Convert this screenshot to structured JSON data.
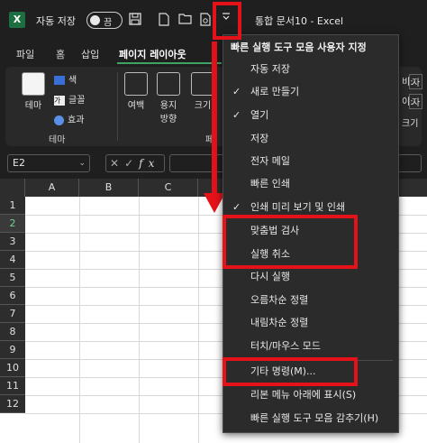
{
  "titlebar": {
    "app_logo": "X",
    "autosave_label": "자동 저장",
    "autosave_state": "끔",
    "window_title": "통합 문서10  -  Excel"
  },
  "tabs": [
    {
      "label": "파일"
    },
    {
      "label": "홈"
    },
    {
      "label": "삽입"
    },
    {
      "label": "페이지 레이아웃",
      "active": true
    }
  ],
  "ribbon": {
    "theme_button": "테마",
    "colors": "색",
    "fonts": "글꼴",
    "effects": "효과",
    "theme_group": "테마",
    "margins": "여백",
    "orientation_l1": "용지",
    "orientation_l2": "방향",
    "size": "크기",
    "page_setup_group_stub": "페",
    "right_a": "비:",
    "right_b": "이:",
    "right_c": "크기",
    "right_a_val": "자",
    "right_b_val": "자"
  },
  "formula_bar": {
    "name_box": "E2",
    "fx": "fx"
  },
  "grid": {
    "columns": [
      "A",
      "B",
      "C"
    ],
    "rows": [
      "1",
      "2",
      "3",
      "4",
      "5",
      "6",
      "7",
      "8",
      "9",
      "10",
      "11",
      "12"
    ],
    "selected_row": "2"
  },
  "qat_menu": {
    "header": "빠른 실행 도구 모음 사용자 지정",
    "items": [
      {
        "label": "자동 저장",
        "checked": false
      },
      {
        "label": "새로 만들기",
        "checked": true
      },
      {
        "label": "열기",
        "checked": true
      },
      {
        "label": "저장",
        "checked": false
      },
      {
        "label": "전자 메일",
        "checked": false
      },
      {
        "label": "빠른 인쇄",
        "checked": false
      },
      {
        "label": "인쇄 미리 보기 및 인쇄",
        "checked": true
      },
      {
        "label": "맞춤법 검사",
        "checked": false
      },
      {
        "label": "실행 취소",
        "checked": false
      },
      {
        "label": "다시 실행",
        "checked": false
      },
      {
        "label": "오름차순 정렬",
        "checked": false
      },
      {
        "label": "내림차순 정렬",
        "checked": false
      },
      {
        "label": "터치/마우스 모드",
        "checked": false
      },
      {
        "label": "기타 명령(M)...",
        "checked": false
      },
      {
        "label": "리본 메뉴 아래에 표시(S)",
        "checked": false
      },
      {
        "label": "빠른 실행 도구 모음 감추기(H)",
        "checked": false
      }
    ],
    "check_glyph": "✓"
  },
  "colors": {
    "excel_green": "#1d6f42",
    "tab_underline": "#3fa264",
    "annotation_red": "#e5121a"
  }
}
